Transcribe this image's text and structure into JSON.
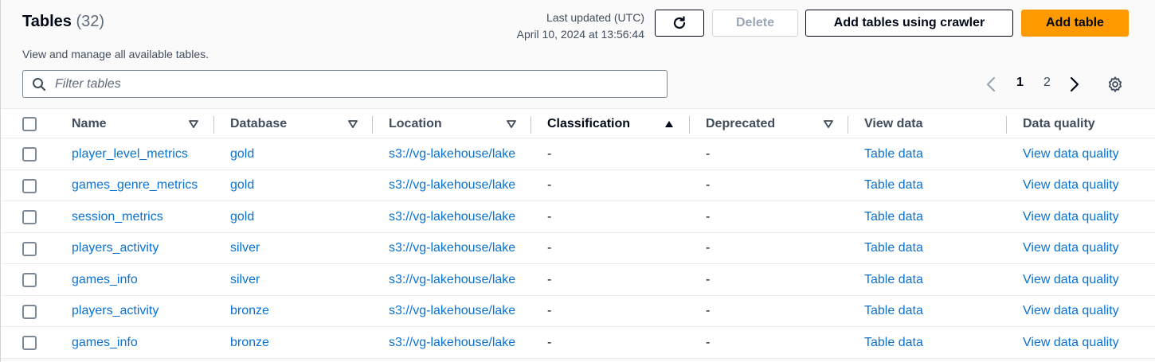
{
  "header": {
    "title": "Tables",
    "count": "(32)",
    "description": "View and manage all available tables.",
    "last_updated_label": "Last updated (UTC)",
    "last_updated_value": "April 10, 2024 at 13:56:44"
  },
  "toolbar": {
    "refresh_icon": "refresh-icon",
    "delete_label": "Delete",
    "crawler_label": "Add tables using crawler",
    "add_label": "Add table",
    "accent_color": "#ff9900"
  },
  "filter": {
    "placeholder": "Filter tables",
    "icon": "search-icon"
  },
  "pagination": {
    "pages": [
      "1",
      "2"
    ],
    "current": "1"
  },
  "columns": [
    {
      "label": "Name"
    },
    {
      "label": "Database"
    },
    {
      "label": "Location"
    },
    {
      "label": "Classification"
    },
    {
      "label": "Deprecated"
    },
    {
      "label": "View data"
    },
    {
      "label": "Data quality"
    }
  ],
  "rows": [
    {
      "name": "player_level_metrics",
      "database": "gold",
      "location": "s3://vg-lakehouse/lake",
      "classification": "-",
      "deprecated": "-",
      "view_data": "Table data",
      "data_quality": "View data quality"
    },
    {
      "name": "games_genre_metrics",
      "database": "gold",
      "location": "s3://vg-lakehouse/lake",
      "classification": "-",
      "deprecated": "-",
      "view_data": "Table data",
      "data_quality": "View data quality"
    },
    {
      "name": "session_metrics",
      "database": "gold",
      "location": "s3://vg-lakehouse/lake",
      "classification": "-",
      "deprecated": "-",
      "view_data": "Table data",
      "data_quality": "View data quality"
    },
    {
      "name": "players_activity",
      "database": "silver",
      "location": "s3://vg-lakehouse/lake",
      "classification": "-",
      "deprecated": "-",
      "view_data": "Table data",
      "data_quality": "View data quality"
    },
    {
      "name": "games_info",
      "database": "silver",
      "location": "s3://vg-lakehouse/lake",
      "classification": "-",
      "deprecated": "-",
      "view_data": "Table data",
      "data_quality": "View data quality"
    },
    {
      "name": "players_activity",
      "database": "bronze",
      "location": "s3://vg-lakehouse/lake",
      "classification": "-",
      "deprecated": "-",
      "view_data": "Table data",
      "data_quality": "View data quality"
    },
    {
      "name": "games_info",
      "database": "bronze",
      "location": "s3://vg-lakehouse/lake",
      "classification": "-",
      "deprecated": "-",
      "view_data": "Table data",
      "data_quality": "View data quality"
    }
  ]
}
